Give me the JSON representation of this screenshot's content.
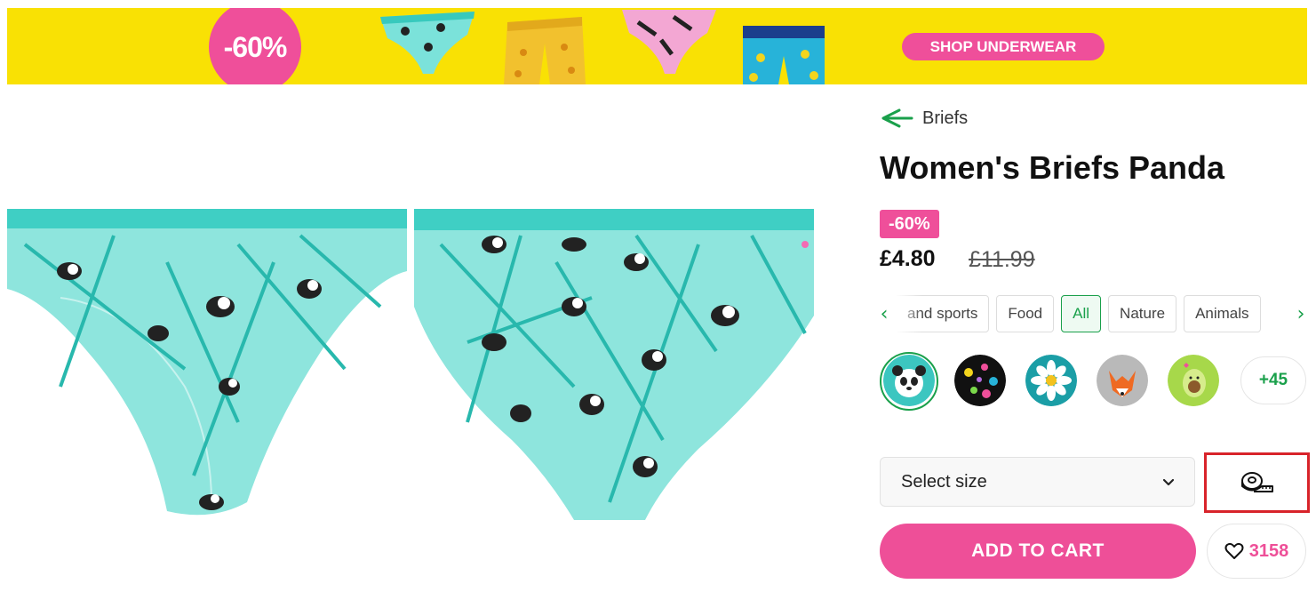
{
  "banner": {
    "discount": "-60%",
    "cta_label": "SHOP UNDERWEAR",
    "background_color": "#f9e104",
    "accent_color": "#ef4f9a"
  },
  "breadcrumb": {
    "back_icon": "arrow-left-icon",
    "label": "Briefs"
  },
  "product": {
    "title": "Women's Briefs Panda",
    "discount_badge": "-60%",
    "price": "£4.80",
    "old_price": "£11.99",
    "images": [
      "front-view",
      "back-view"
    ],
    "print_color": "#6fe0d8"
  },
  "categories": {
    "items": [
      {
        "label": "and sports"
      },
      {
        "label": "Food"
      },
      {
        "label": "All"
      },
      {
        "label": "Nature"
      },
      {
        "label": "Animals"
      }
    ],
    "selected": "All",
    "prev_icon": "chevron-left-icon",
    "next_icon": "chevron-right-icon",
    "accent_color": "#1aa04b"
  },
  "swatches": {
    "items": [
      {
        "name": "panda",
        "selected": true
      },
      {
        "name": "dots"
      },
      {
        "name": "daisy"
      },
      {
        "name": "fox"
      },
      {
        "name": "avocado"
      }
    ],
    "more_label": "+45"
  },
  "size": {
    "placeholder": "Select size",
    "dropdown_icon": "chevron-down-icon",
    "guide_icon": "measuring-tape-icon"
  },
  "actions": {
    "add_to_cart_label": "ADD TO CART",
    "wishlist_icon": "heart-icon",
    "wishlist_count": "3158",
    "primary_color": "#ee4f98"
  }
}
